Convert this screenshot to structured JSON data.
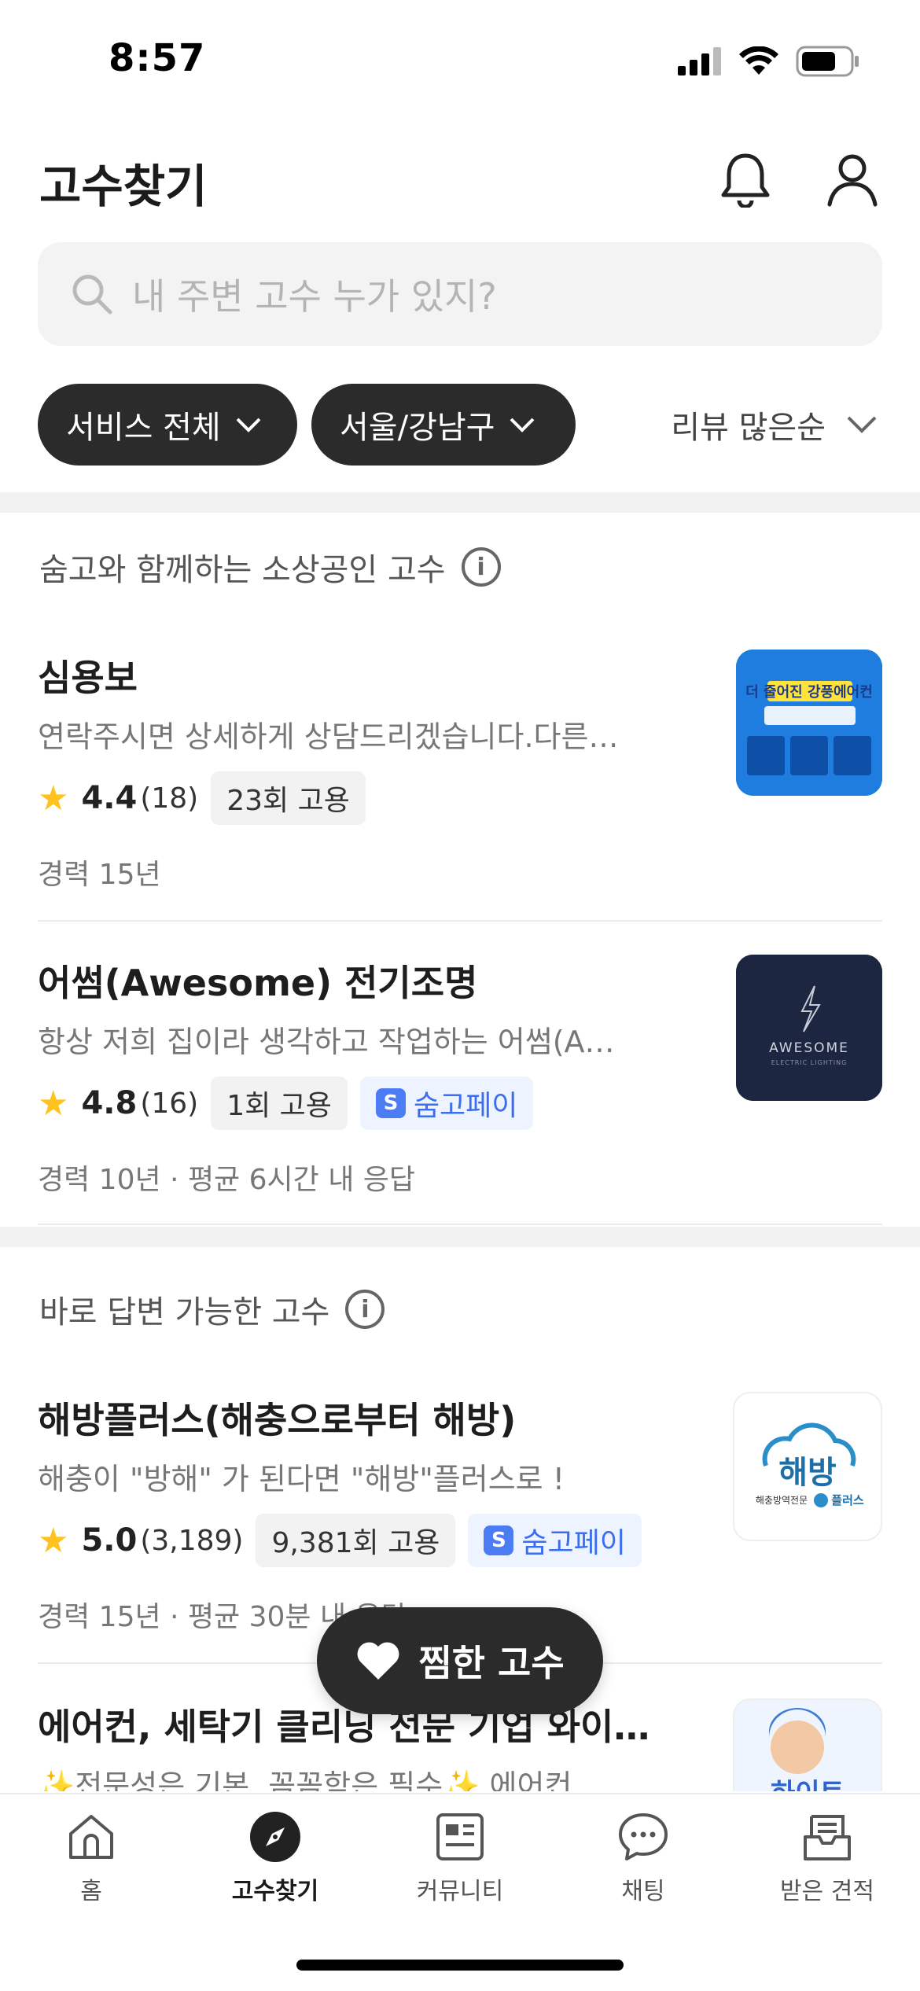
{
  "status_bar": {
    "time": "8:57"
  },
  "header": {
    "title": "고수찾기"
  },
  "search": {
    "placeholder": "내 주변 고수 누가 있지?"
  },
  "filters": {
    "service": "서비스 전체",
    "region": "서울/강남구",
    "sort": "리뷰 많은순"
  },
  "sections": [
    {
      "title": "숨고와 함께하는 소상공인 고수",
      "cards": [
        {
          "name": "심용보",
          "desc": "연락주시면 상세하게 상담드리겠습니다.다른…",
          "rating": "4.4",
          "reviews": "(18)",
          "hires": "23회 고용",
          "pay": "",
          "extra": "경력 15년",
          "thumb_text": "더 줄어진 강풍에어컨"
        },
        {
          "name": "어썸(Awesome) 전기조명",
          "desc": "항상 저희 집이라 생각하고 작업하는 어썸(A…",
          "rating": "4.8",
          "reviews": "(16)",
          "hires": "1회 고용",
          "pay": "숨고페이",
          "extra": "경력 10년 · 평균 6시간 내 응답",
          "thumb_text": "AWESOME",
          "thumb_sub": "ELECTRIC LIGHTING"
        }
      ]
    },
    {
      "title": "바로 답변 가능한 고수",
      "cards": [
        {
          "name": "해방플러스(해충으로부터 해방)",
          "desc": "해충이 \"방해\" 가 된다면 \"해방\"플러스로 !",
          "rating": "5.0",
          "reviews": "(3,189)",
          "hires": "9,381회 고용",
          "pay": "숨고페이",
          "extra": "경력 15년 · 평균 30분 내 응답",
          "thumb_text": "해방",
          "thumb_sub": "해충방역전문",
          "thumb_plus": "플러스"
        },
        {
          "name": "에어컨, 세탁기 클리닝 전문 기업 와이…",
          "desc": "✨전문성은 기본, 꼼꼼함은 필수✨ 에어컨 ,…",
          "thumb_text": "하이트"
        }
      ]
    }
  ],
  "fab": {
    "label": "찜한 고수"
  },
  "tabs": [
    {
      "label": "홈",
      "icon": "home-icon"
    },
    {
      "label": "고수찾기",
      "icon": "compass-icon",
      "active": true
    },
    {
      "label": "커뮤니티",
      "icon": "community-icon"
    },
    {
      "label": "채팅",
      "icon": "chat-icon"
    },
    {
      "label": "받은 견적",
      "icon": "inbox-icon"
    }
  ],
  "colors": {
    "star": "#ffc21f",
    "pay_blue": "#3a6df0",
    "chip_dark": "#2b2b2b"
  }
}
